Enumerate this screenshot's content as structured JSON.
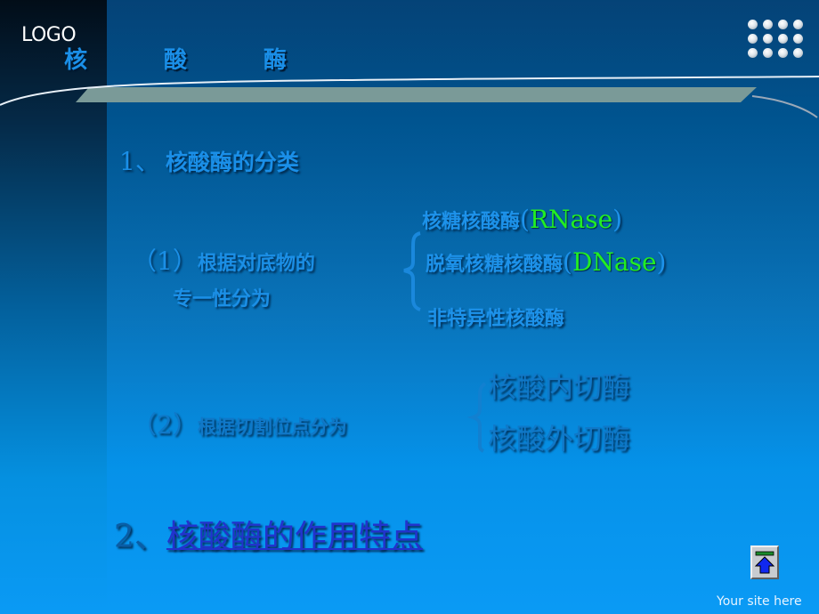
{
  "header": {
    "logo": "LOGO",
    "title_chars": [
      "核",
      "酸",
      "酶"
    ]
  },
  "section1": {
    "number": "1、",
    "title": "核酸酶的分类",
    "sub1": {
      "number": "（1）",
      "line1": "根据对底物的",
      "line2": "专一性分为",
      "items": [
        {
          "text": "核糖核酸酶",
          "paren_open": "(",
          "abbr": "RNase",
          "paren_close": ")"
        },
        {
          "text": "脱氧核糖核酸酶",
          "paren_open": "(",
          "abbr": "DNase",
          "paren_close": ")"
        },
        {
          "text": "非特异性核酸酶"
        }
      ]
    },
    "sub2": {
      "number": "（2）",
      "label": "根据切割位点分为",
      "items": [
        "核酸内切酶",
        "核酸外切酶"
      ]
    }
  },
  "section2": {
    "number": "2、",
    "link_text": "核酸酶的作用特点"
  },
  "footer": {
    "nav_button_icon": "up-arrow-icon",
    "site_text": "Your site here"
  },
  "colors": {
    "abbr_green": "#22ee22",
    "link_blue": "#2233cc",
    "heading_blue": "#1a8fe8"
  }
}
